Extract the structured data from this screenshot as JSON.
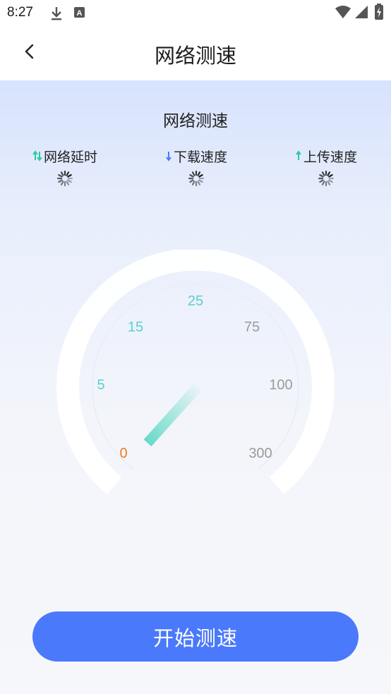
{
  "status_bar": {
    "time": "8:27",
    "icons": [
      "download-icon",
      "text-a-icon",
      "wifi-icon",
      "signal-icon",
      "battery-charging-icon"
    ]
  },
  "header": {
    "back_icon": "chevron-left-icon",
    "title": "网络测速"
  },
  "card": {
    "title": "网络测速",
    "metrics": [
      {
        "label": "网络延时",
        "icon": "up-down-arrows-icon",
        "color": "#2fc7a6"
      },
      {
        "label": "下载速度",
        "icon": "down-arrow-icon",
        "color": "#4a79fb"
      },
      {
        "label": "上传速度",
        "icon": "up-arrow-icon",
        "color": "#2fc7a6"
      }
    ]
  },
  "gauge": {
    "ticks": [
      "0",
      "5",
      "15",
      "25",
      "75",
      "100",
      "300"
    ],
    "active_color": "#5bcfd0",
    "zero_color": "#f07b1d",
    "inactive_color": "#9b9b9b",
    "needle_color": "#5fd9c3"
  },
  "start_button": {
    "label": "开始测速",
    "color": "#4a79fb"
  }
}
